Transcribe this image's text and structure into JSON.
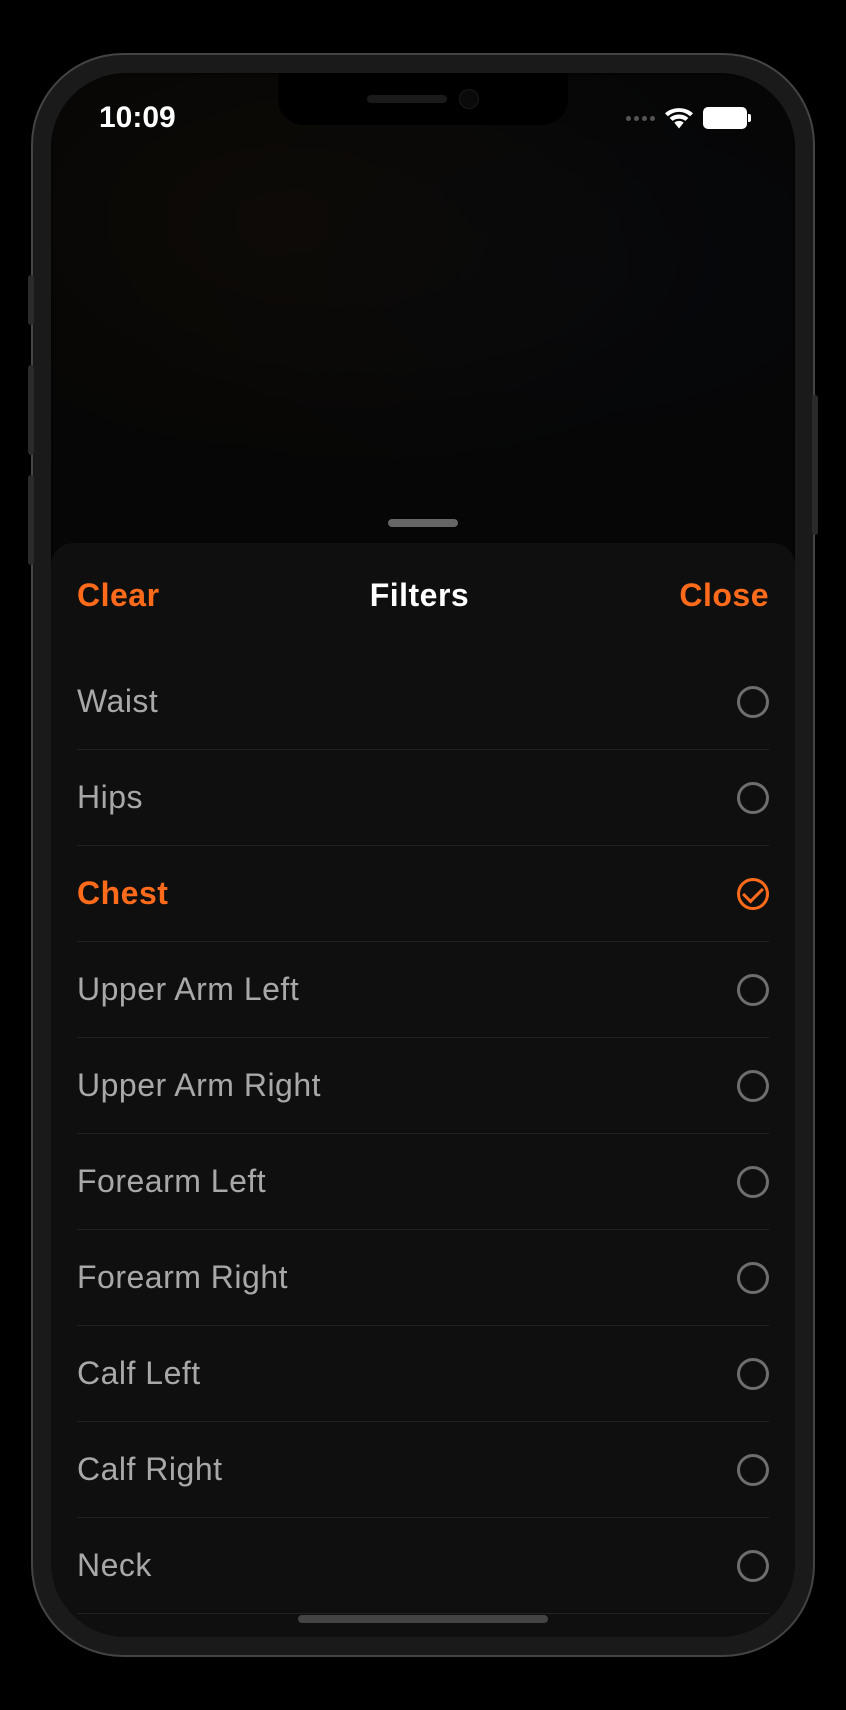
{
  "status": {
    "time": "10:09"
  },
  "sheet": {
    "clear_label": "Clear",
    "title": "Filters",
    "close_label": "Close"
  },
  "filters": [
    {
      "label": "Waist",
      "selected": false
    },
    {
      "label": "Hips",
      "selected": false
    },
    {
      "label": "Chest",
      "selected": true
    },
    {
      "label": "Upper Arm Left",
      "selected": false
    },
    {
      "label": "Upper Arm Right",
      "selected": false
    },
    {
      "label": "Forearm Left",
      "selected": false
    },
    {
      "label": "Forearm Right",
      "selected": false
    },
    {
      "label": "Calf Left",
      "selected": false
    },
    {
      "label": "Calf Right",
      "selected": false
    },
    {
      "label": "Neck",
      "selected": false
    }
  ],
  "accent_color": "#ff6b1a"
}
